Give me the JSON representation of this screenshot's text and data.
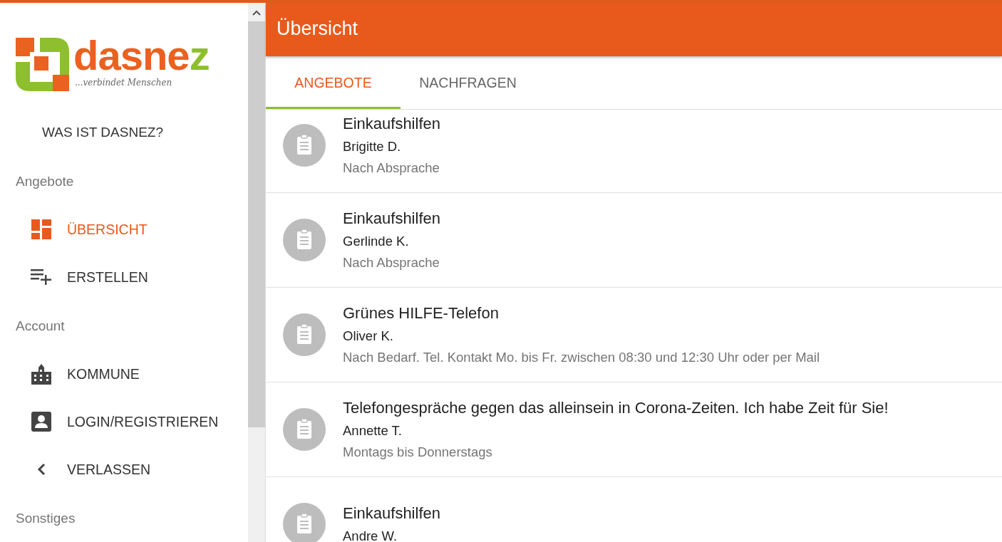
{
  "logo": {
    "name": "dasnez",
    "tagline": "...verbindet Menschen"
  },
  "sidebar": {
    "about_link": "WAS IST DASNEZ?",
    "sections": [
      {
        "heading": "Angebote",
        "items": [
          {
            "label": "ÜBERSICHT",
            "kind": "dashboard",
            "selected": true
          },
          {
            "label": "ERSTELLEN",
            "kind": "create",
            "selected": false
          }
        ]
      },
      {
        "heading": "Account",
        "items": [
          {
            "label": "KOMMUNE",
            "kind": "municipality",
            "selected": false
          },
          {
            "label": "LOGIN/REGISTRIEREN",
            "kind": "login",
            "selected": false
          },
          {
            "label": "VERLASSEN",
            "kind": "leave",
            "selected": false
          }
        ]
      },
      {
        "heading": "Sonstiges"
      }
    ]
  },
  "header": {
    "title": "Übersicht"
  },
  "tabs": [
    {
      "label": "ANGEBOTE",
      "selected": true
    },
    {
      "label": "NACHFRAGEN",
      "selected": false
    }
  ],
  "offers": [
    {
      "title": "Einkaufshilfen",
      "person": "Brigitte D.",
      "availability": "Nach Absprache"
    },
    {
      "title": "Einkaufshilfen",
      "person": "Gerlinde K.",
      "availability": "Nach Absprache"
    },
    {
      "title": "Grünes HILFE-Telefon",
      "person": "Oliver K.",
      "availability": "Nach Bedarf. Tel. Kontakt Mo. bis Fr. zwischen 08:30 und 12:30 Uhr oder per Mail"
    },
    {
      "title": "Telefongespräche gegen das alleinsein in Corona-Zeiten. Ich habe Zeit für Sie!",
      "person": "Annette T.",
      "availability": "Montags bis Donnerstags"
    },
    {
      "title": "Einkaufshilfen",
      "person": "Andre W."
    }
  ]
}
